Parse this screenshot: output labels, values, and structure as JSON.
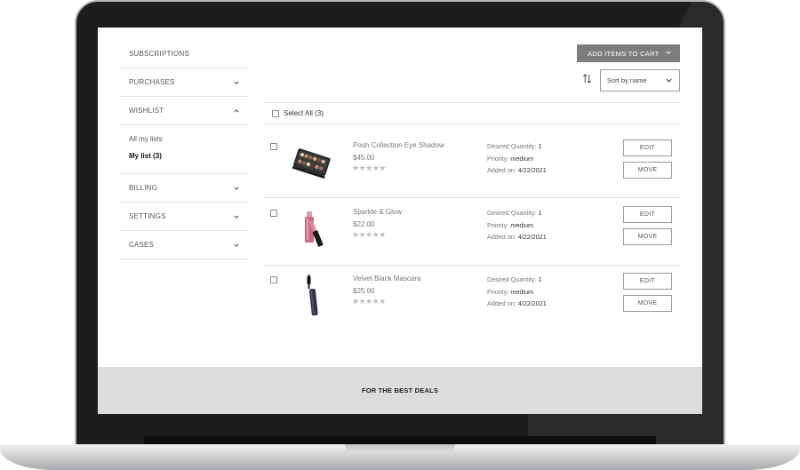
{
  "sidebar": {
    "items": [
      {
        "label": "SUBSCRIPTIONS",
        "icon": ""
      },
      {
        "label": "PURCHASES",
        "icon": "chevron-down-icon"
      },
      {
        "label": "WISHLIST",
        "icon": "chevron-up-icon"
      },
      {
        "label": "BILLING",
        "icon": "chevron-down-icon"
      },
      {
        "label": "SETTINGS",
        "icon": "chevron-down-icon"
      },
      {
        "label": "CASES",
        "icon": "chevron-down-icon"
      }
    ],
    "wishlist_sub": {
      "all_lists": "All my lists",
      "my_list": "My list (3)"
    }
  },
  "toolbar": {
    "add_to_cart_label": "ADD ITEMS TO CART",
    "sort_value": "Sort by name",
    "select_all_label": "Select All (3)"
  },
  "products": [
    {
      "name": "Posh Collection Eye Shadow",
      "price": "$45.00",
      "rating_stars": 0,
      "stars": "★★★★★",
      "qty_label": "Desired Quantity:",
      "qty": "1",
      "priority_label": "Priority:",
      "priority": "medium",
      "added_label": "Added on:",
      "added": "4/22/2021",
      "edit": "EDIT",
      "move": "MOVE",
      "image": "eyeshadow-palette"
    },
    {
      "name": "Sparkle & Glow",
      "price": "$22.00",
      "rating_stars": 0,
      "stars": "★★★★★",
      "qty_label": "Desired Quantity:",
      "qty": "1",
      "priority_label": "Priority:",
      "priority": "medium",
      "added_label": "Added on:",
      "added": "4/22/2021",
      "edit": "EDIT",
      "move": "MOVE",
      "image": "lip-gloss"
    },
    {
      "name": "Velvet Black Mascara",
      "price": "$25.00",
      "rating_stars": 0,
      "stars": "★★★★★",
      "qty_label": "Desired Quantity:",
      "qty": "1",
      "priority_label": "Priority:",
      "priority": "medium",
      "added_label": "Added on:",
      "added": "4/22/2021",
      "edit": "EDIT",
      "move": "MOVE",
      "image": "mascara"
    }
  ],
  "footer": {
    "banner": "FOR THE BEST DEALS"
  },
  "colors": {
    "button_gray": "#7d7d7d",
    "footer_band": "#dcdcdc",
    "laptop_bezel": "#1d1d1f"
  }
}
